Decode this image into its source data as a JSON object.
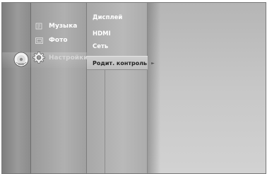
{
  "main_menu": {
    "items": [
      {
        "label": "Музыка",
        "icon": "music-icon"
      },
      {
        "label": "Фото",
        "icon": "photo-icon"
      },
      {
        "label": "Настройки",
        "icon": "gear-icon"
      }
    ]
  },
  "settings_menu": {
    "items": [
      {
        "label": "Дисплей"
      },
      {
        "label": "HDMI"
      },
      {
        "label": "Сеть"
      },
      {
        "label": "Родит. контроль"
      }
    ]
  },
  "icons": {
    "disc": "dvd-disc-icon",
    "selection_arrow": "arrow-right-icon"
  }
}
